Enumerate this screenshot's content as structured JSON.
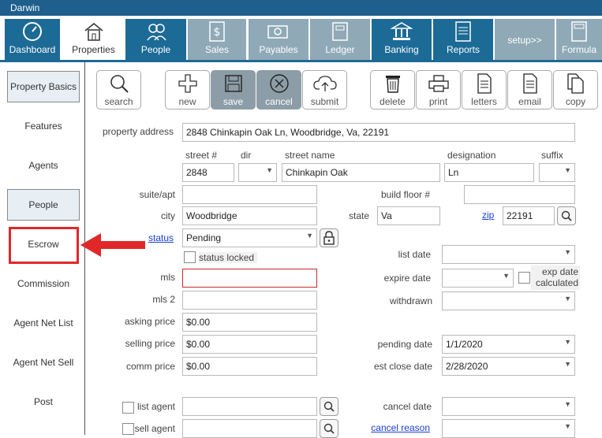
{
  "window": {
    "title": "Darwin"
  },
  "nav": {
    "tabs": [
      {
        "label": "Dashboard",
        "icon": "gauge-icon"
      },
      {
        "label": "Properties",
        "icon": "house-icon"
      },
      {
        "label": "People",
        "icon": "people-icon"
      },
      {
        "label": "Sales",
        "icon": "dollar-doc-icon"
      },
      {
        "label": "Payables",
        "icon": "money-icon"
      },
      {
        "label": "Ledger",
        "icon": "ledger-icon"
      },
      {
        "label": "Banking",
        "icon": "bank-icon"
      },
      {
        "label": "Reports",
        "icon": "report-icon"
      },
      {
        "label": "setup>>",
        "icon": ""
      },
      {
        "label": "Formula",
        "icon": "calculator-icon"
      }
    ]
  },
  "sidebar": {
    "items": [
      {
        "label": "Property Basics"
      },
      {
        "label": "Features"
      },
      {
        "label": "Agents"
      },
      {
        "label": "People"
      },
      {
        "label": "Escrow"
      },
      {
        "label": "Commission"
      },
      {
        "label": "Agent Net List"
      },
      {
        "label": "Agent Net Sell"
      },
      {
        "label": "Post"
      }
    ]
  },
  "toolbar": {
    "search": "search",
    "new": "new",
    "save": "save",
    "cancel": "cancel",
    "submit": "submit",
    "delete": "delete",
    "print": "print",
    "letters": "letters",
    "email": "email",
    "copy": "copy"
  },
  "form": {
    "property_address_label": "property address",
    "property_address": "2848 Chinkapin Oak Ln, Woodbridge, Va, 22191",
    "street_num_label": "street #",
    "street_num": "2848",
    "dir_label": "dir",
    "dir": "",
    "street_name_label": "street name",
    "street_name": "Chinkapin Oak",
    "designation_label": "designation",
    "designation": "Ln",
    "suffix_label": "suffix",
    "suffix": "",
    "suite_label": "suite/apt",
    "suite": "",
    "build_floor_label": "build floor #",
    "build_floor": "",
    "city_label": "city",
    "city": "Woodbridge",
    "state_label": "state",
    "state": "Va",
    "zip_label": "zip",
    "zip": "22191",
    "status_label": "status",
    "status": "Pending",
    "status_locked_label": "status locked",
    "list_date_label": "list date",
    "list_date": "",
    "mls_label": "mls",
    "mls": "",
    "expire_date_label": "expire date",
    "expire_date": "",
    "exp_calc_label_1": "exp date",
    "exp_calc_label_2": "calculated",
    "mls2_label": "mls 2",
    "mls2": "",
    "withdrawn_label": "withdrawn",
    "withdrawn": "",
    "asking_price_label": "asking price",
    "asking_price": "$0.00",
    "selling_price_label": "selling price",
    "selling_price": "$0.00",
    "pending_date_label": "pending date",
    "pending_date": "1/1/2020",
    "comm_price_label": "comm price",
    "comm_price": "$0.00",
    "est_close_label": "est close date",
    "est_close": "2/28/2020",
    "list_agent_label": "list agent",
    "list_agent": "",
    "cancel_date_label": "cancel date",
    "cancel_date": "",
    "sell_agent_label": "sell agent",
    "sell_agent": "",
    "cancel_reason_label": "cancel reason",
    "cancel_reason": ""
  },
  "colors": {
    "nav_dark": "#1c6a96",
    "nav_light": "#8fa9b7",
    "highlight": "#e0282b"
  }
}
